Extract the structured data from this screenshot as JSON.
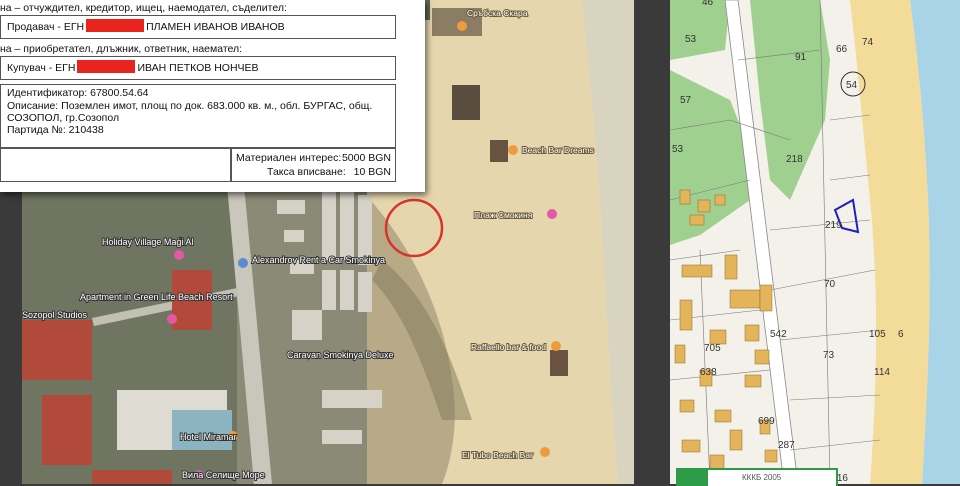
{
  "document": {
    "line1": "на – отчуждител, кредитор, ищец, наемодател, съделител:",
    "seller_prefix": "Продавач - ЕГН",
    "seller_name": "ПЛАМЕН ИВАНОВ ИВАНОВ",
    "line2": "на – приобретател, длъжник, ответник, наемател:",
    "buyer_prefix": "Купувач - ЕГН",
    "buyer_name": "ИВАН ПЕТКОВ НОНЧЕВ",
    "identifier": "Идентификатор: 67800.54.64",
    "description1": "Описание: Поземлен имот, площ по док. 683.000 кв. м., обл. БУРГАС, общ.",
    "description2": "СОЗОПОЛ, гр.Созопол",
    "batch": "Партида №: 210438",
    "interest_label": "Материален интерес:",
    "interest_value": "5000 BGN",
    "fee_label": "Такса вписване:",
    "fee_value": "10 BGN"
  },
  "satellite": {
    "labels": {
      "srabska": "Сръбска Скара",
      "beachbar_dreams": "Beach Bar Dreams",
      "plazh": "Плаж Смокиня",
      "holiday_village": "Holiday Village Maģi Al",
      "alexandrov": "Alexandrov Rent a Car Smokinya",
      "apartment": "Apartment in Green Life Beach Resort",
      "sozopol_studios": "Sozopol Studios",
      "caravan": "Caravan Smokinya Deluxe",
      "raffaello": "Raffaello bar & food",
      "hotel_miramar": "Hotel Miramar",
      "vila": "Вила Селище Море",
      "el_tubo": "El Tubo Beach Bar"
    }
  },
  "cadastre": {
    "parcels": [
      "46",
      "53",
      "91",
      "66",
      "74",
      "57",
      "54",
      "53",
      "218",
      "219",
      "70",
      "542",
      "105",
      "6",
      "705",
      "73",
      "638",
      "114",
      "699",
      "287",
      "116"
    ],
    "tab_text": "КККБ 2005"
  },
  "colors": {
    "highlight_circle": "#d9342b",
    "selected_parcel": "#1f1fc0",
    "green_area": "#9fd08f",
    "sand": "#f3dc9a",
    "sea": "#a9d3e6",
    "building": "#e3b45a",
    "redaction": "#e8241c"
  }
}
